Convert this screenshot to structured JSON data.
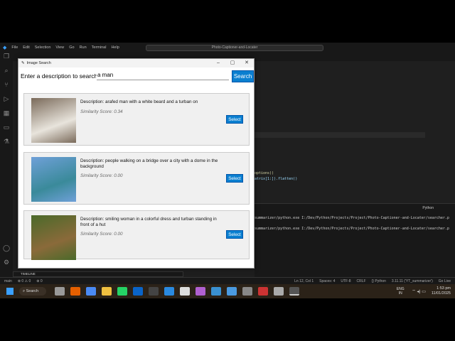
{
  "vscode": {
    "menu": [
      "File",
      "Edit",
      "Selection",
      "View",
      "Go",
      "Run",
      "Terminal",
      "Help"
    ],
    "command_center": "Photo-Captioner-and-Locater",
    "code": [
      "options))",
      "atrix[1:]).flatten()"
    ],
    "terminal_tab": "Python",
    "terminal_lines": [
      "summarizer/python.exe I:/Dev/Python/Projects/Project/Photo-Captioner-and-Locater/searcher.p",
      "summarizer/python.exe I:/Dev/Python/Projects/Project/Photo-Captioner-and-Locater/searcher.p"
    ],
    "timeline": "TIMELINE",
    "status_left": [
      "main",
      "⊗ 0 ⚠ 0",
      "⊕ 0"
    ],
    "status_right": [
      "Ln 12, Col 1",
      "Spaces: 4",
      "UTF-8",
      "CRLF",
      "{} Python",
      "3.11.11 ('YT_summarizer')",
      "Go Live"
    ]
  },
  "dialog": {
    "title": "Image Search",
    "search_label": "Enter a description to search:",
    "search_value": "a man",
    "search_button": "Search",
    "results": [
      {
        "description": "Description: arafed man with a white beard and a turban on",
        "score": "Similarity Score: 0.34",
        "select": "Select",
        "colors": [
          "#7a6a5a",
          "#e8e4dc"
        ]
      },
      {
        "description": "Description: people walking on a bridge over a city with a dome in the background",
        "score": "Similarity Score: 0.00",
        "select": "Select",
        "colors": [
          "#6fa0d8",
          "#3a8a9a"
        ]
      },
      {
        "description": "Description: smiling woman in a colorful dress and turban standing in front of a hut",
        "score": "Similarity Score: 0.00",
        "select": "Select",
        "colors": [
          "#4a6a2a",
          "#8a6a3a"
        ]
      }
    ]
  },
  "taskbar": {
    "search": "Search",
    "lang": "ENG IN",
    "time": "1:53 pm",
    "date": "11/01/2025"
  }
}
